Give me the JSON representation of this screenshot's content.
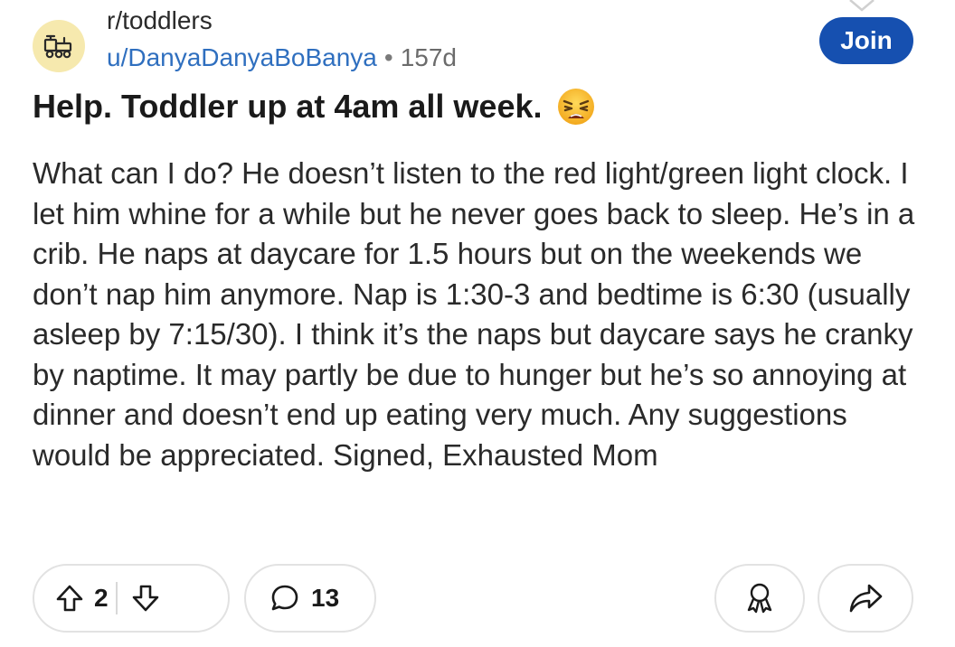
{
  "post": {
    "subreddit": "r/toddlers",
    "username": "u/DanyaDanyaBoBanya",
    "separator": "•",
    "age": "157d",
    "join_label": "Join",
    "title": "Help. Toddler up at 4am all week.",
    "body": "What can I do? He doesn’t listen to the red light/green light clock. I let him whine for a while but he never goes back to sleep. He’s in a crib. He naps at daycare for 1.5 hours but on the weekends we don’t nap him anymore. Nap is 1:30-3 and bedtime is 6:30 (usually asleep by 7:15/30). I think it’s the naps but daycare says he cranky by naptime. It may partly be due to hunger but he’s so annoying at dinner and doesn’t end up eating very much. Any suggestions would be appreciated. Signed, Exhausted Mom"
  },
  "actions": {
    "upvote_count": "2",
    "comment_count": "13"
  },
  "icons": {
    "avatar": "toy-train-icon",
    "title_emoji": "weary-face-emoji",
    "upvote": "upvote-arrow-icon",
    "downvote": "downvote-arrow-icon",
    "comment": "comment-bubble-icon",
    "award": "award-ribbon-icon",
    "share": "share-arrow-icon"
  },
  "colors": {
    "join_button": "#1650b0",
    "username": "#2f6fbf",
    "avatar_bg": "#f6e9ae"
  }
}
